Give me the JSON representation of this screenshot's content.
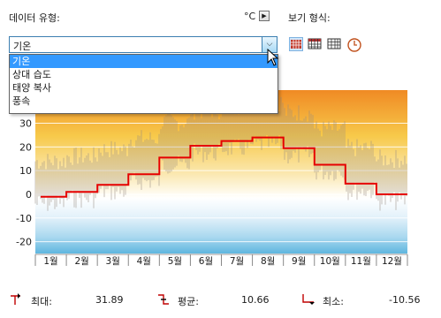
{
  "header": {
    "data_type_label": "데이터 유형:",
    "unit_label": "°C",
    "view_format_label": "보기 형식:"
  },
  "combo": {
    "selected": "기온",
    "options": [
      "기온",
      "상대 습도",
      "태양 복사",
      "풍속"
    ]
  },
  "view_buttons": [
    "bar-grid-icon",
    "dense-grid-icon",
    "table-icon",
    "clock-icon"
  ],
  "colors": {
    "accent": "#3399ff",
    "line": "#e60000",
    "hot": "#f08a24",
    "warm": "#f7c94a",
    "cold": "#5fb6df"
  },
  "chart_data": {
    "type": "line",
    "categories": [
      "1월",
      "2월",
      "3월",
      "4월",
      "5월",
      "6월",
      "7월",
      "8월",
      "9월",
      "10월",
      "11월",
      "12월"
    ],
    "ylim": [
      -25,
      44
    ],
    "yticks": [
      30,
      20,
      10,
      0,
      -10,
      -20
    ],
    "series": [
      {
        "values": [
          -1,
          1,
          4,
          8.5,
          15.5,
          20.5,
          22.5,
          24,
          19.5,
          12.5,
          4.5,
          0
        ]
      }
    ]
  },
  "stats": {
    "max_label": "최대:",
    "max_value": "31.89",
    "avg_label": "평균:",
    "avg_value": "10.66",
    "min_label": "최소:",
    "min_value": "-10.56"
  }
}
